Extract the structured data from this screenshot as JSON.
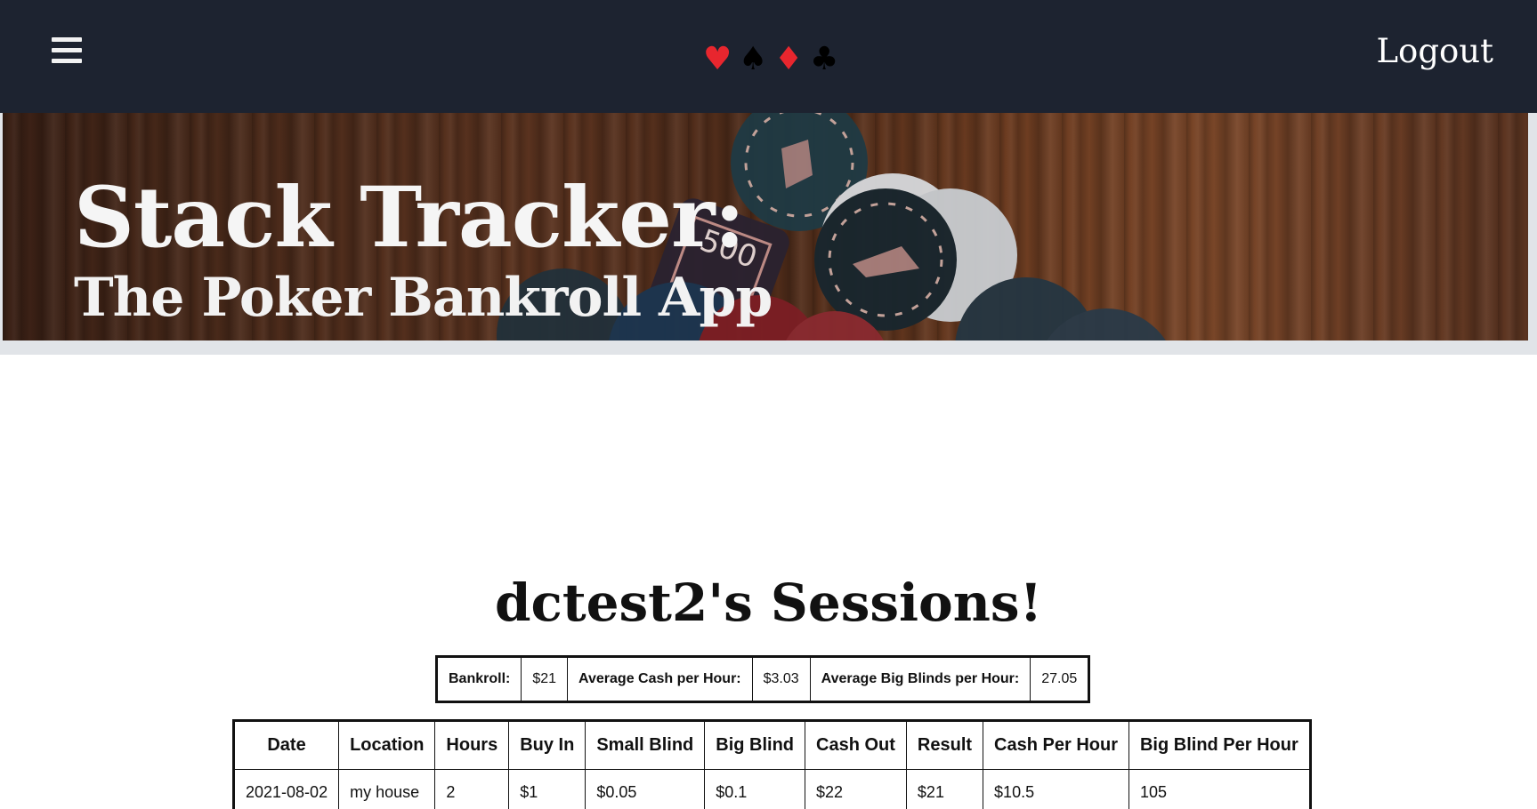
{
  "navbar": {
    "menu_icon": "hamburger-menu-icon",
    "suits": [
      {
        "glyph": "♥",
        "color": "#e8262e",
        "icon": "heart-icon"
      },
      {
        "glyph": "♠",
        "color": "#000000",
        "icon": "spade-icon"
      },
      {
        "glyph": "♦",
        "color": "#e8262e",
        "icon": "diamond-icon"
      },
      {
        "glyph": "♣",
        "color": "#000000",
        "icon": "club-icon"
      }
    ],
    "logout_label": "Logout",
    "background": "#1d2330"
  },
  "hero": {
    "title": "Stack Tracker:",
    "subtitle": "The Poker Bankroll App"
  },
  "main": {
    "title": "dctest2's Sessions!",
    "stats": {
      "bankroll_label": "Bankroll:",
      "bankroll_value": "$21",
      "avg_cash_label": "Average Cash per Hour:",
      "avg_cash_value": "$3.03",
      "avg_bb_label": "Average Big Blinds per Hour:",
      "avg_bb_value": "27.05"
    },
    "sessions_table": {
      "headers": [
        "Date",
        "Location",
        "Hours",
        "Buy In",
        "Small Blind",
        "Big Blind",
        "Cash Out",
        "Result",
        "Cash Per Hour",
        "Big Blind Per Hour"
      ],
      "rows": [
        [
          "2021-08-02",
          "my house",
          "2",
          "$1",
          "$0.05",
          "$0.1",
          "$22",
          "$21",
          "$10.5",
          "105"
        ]
      ]
    }
  }
}
